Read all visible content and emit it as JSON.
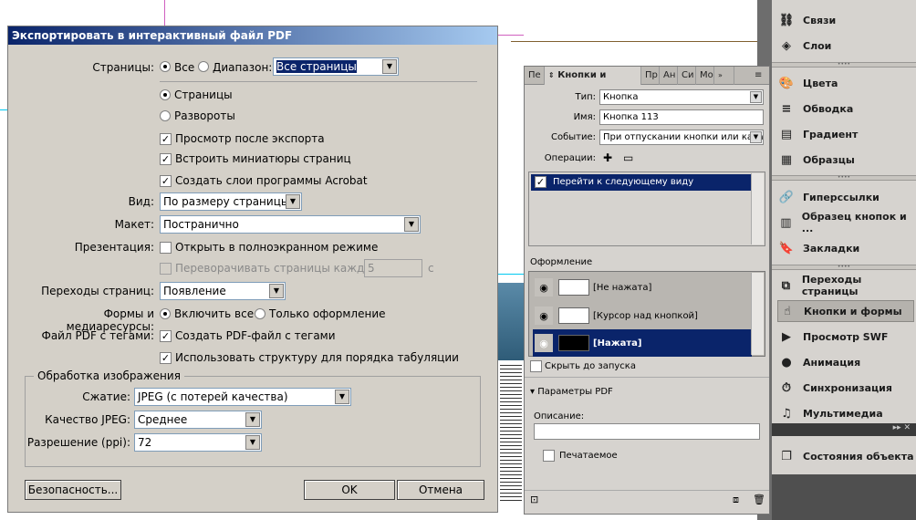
{
  "dialog": {
    "title": "Экспортировать в интерактивный файл PDF",
    "pages_label": "Страницы:",
    "all": "Все",
    "range": "Диапазон:",
    "range_value": "Все страницы",
    "pages_opt": "Страницы",
    "spreads_opt": "Развороты",
    "view_after": "Просмотр после экспорта",
    "embed_thumbs": "Встроить миниатюры страниц",
    "acrobat_layers": "Создать слои программы Acrobat",
    "view_label": "Вид:",
    "view_value": "По размеру страницы",
    "layout_label": "Макет:",
    "layout_value": "Постранично",
    "presentation_label": "Презентация:",
    "fullscreen": "Открыть в полноэкранном режиме",
    "flip_pages": "Переворачивать страницы каждые:",
    "flip_value": "5",
    "flip_unit": "с",
    "transitions_label": "Переходы страниц:",
    "transitions_value": "Появление",
    "forms_label": "Формы и медиаресурсы:",
    "include_all": "Включить все",
    "appearance_only": "Только оформление",
    "tagged_label": "Файл PDF с тегами:",
    "tagged_create": "Создать PDF-файл с тегами",
    "tab_order": "Использовать структуру для порядка табуляции",
    "image_group": "Обработка изображения",
    "compression_label": "Сжатие:",
    "compression_value": "JPEG (с потерей качества)",
    "jpeg_label": "Качество JPEG:",
    "jpeg_value": "Среднее",
    "res_label": "Разрешение (ppi):",
    "res_value": "72",
    "security_btn": "Безопасность...",
    "ok_btn": "OK",
    "cancel_btn": "Отмена"
  },
  "panel": {
    "tabs": [
      "Пе",
      "Кнопки и формы",
      "Пр",
      "Ан",
      "Си",
      "Мо"
    ],
    "menu_icon": "≡",
    "type_label": "Тип:",
    "type_value": "Кнопка",
    "name_label": "Имя:",
    "name_value": "Кнопка 113",
    "event_label": "Событие:",
    "event_value": "При отпускании кнопки или касании",
    "ops_label": "Операции:",
    "action": "Перейти к следующему виду",
    "appearance_label": "Оформление",
    "states": [
      "[Не нажата]",
      "[Курсор над кнопкой]",
      "[Нажата]"
    ],
    "hide_until": "Скрыть до запуска",
    "pdf_options": "Параметры PDF",
    "desc_label": "Описание:",
    "printable": "Печатаемое"
  },
  "right_panel": {
    "items1": [
      "Связи",
      "Слои"
    ],
    "items2": [
      "Цвета",
      "Обводка",
      "Градиент",
      "Образцы"
    ],
    "items3": [
      "Гиперссылки",
      "Образец кнопок и ...",
      "Закладки"
    ],
    "items4": [
      "Переходы страницы",
      "Кнопки и формы",
      "Просмотр SWF",
      "Анимация",
      "Синхронизация",
      "Мультимедиа"
    ],
    "items5": [
      "Состояния объекта"
    ]
  },
  "colors": {
    "title_start": "#0a246a",
    "selection": "#0a246a",
    "dialog_bg": "#d4d0c8"
  }
}
